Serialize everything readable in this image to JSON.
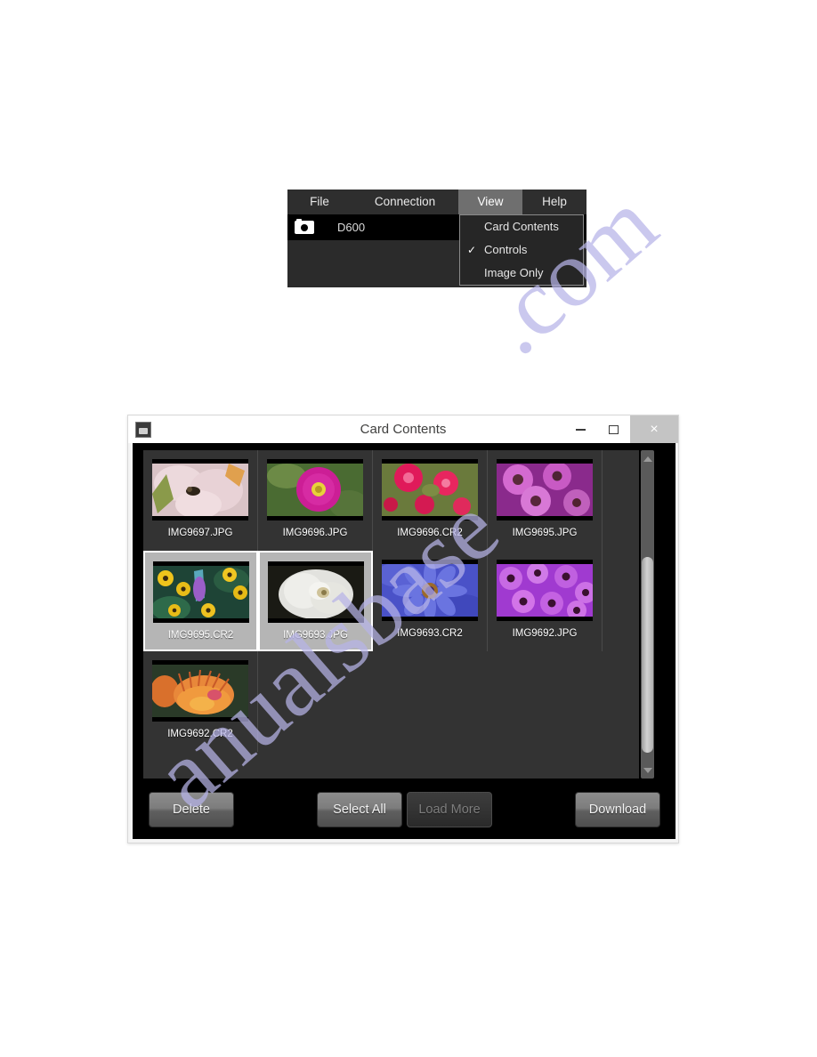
{
  "menu_figure": {
    "menubar": [
      {
        "label": "File",
        "active": false
      },
      {
        "label": "Connection",
        "active": false
      },
      {
        "label": "View",
        "active": true
      },
      {
        "label": "Help",
        "active": false
      }
    ],
    "device": {
      "icon": "camera-icon",
      "name": "D600"
    },
    "dropdown": {
      "parent": "View",
      "items": [
        {
          "label": "Card Contents",
          "checked": false
        },
        {
          "label": "Controls",
          "checked": true
        },
        {
          "label": "Image Only",
          "checked": false
        }
      ],
      "check_glyph": "✓"
    }
  },
  "window": {
    "icon": "app-camera-icon",
    "title": "Card Contents",
    "controls": {
      "minimize": "–",
      "maximize": "□",
      "close": "×"
    },
    "grid": {
      "rows": [
        [
          {
            "filename": "IMG9697.JPG",
            "selected": false
          },
          {
            "filename": "IMG9696.JPG",
            "selected": false
          },
          {
            "filename": "IMG9696.CR2",
            "selected": false
          },
          {
            "filename": "IMG9695.JPG",
            "selected": false
          }
        ],
        [
          {
            "filename": "IMG9695.CR2",
            "selected": true
          },
          {
            "filename": "IMG9693.JPG",
            "selected": true
          },
          {
            "filename": "IMG9693.CR2",
            "selected": false
          },
          {
            "filename": "IMG9692.JPG",
            "selected": false
          }
        ],
        [
          {
            "filename": "IMG9692.CR2",
            "selected": false
          }
        ]
      ]
    },
    "scrollbar": {
      "up_arrow": "scroll-up-arrow",
      "down_arrow": "scroll-down-arrow"
    },
    "buttons": {
      "delete": "Delete",
      "select_all": "Select All",
      "load_more": "Load More",
      "load_more_disabled": true,
      "download": "Download"
    }
  },
  "watermark": {
    "line_a": ".com",
    "line_b": "anualsbase"
  },
  "colors": {
    "menubar_bg": "#2e2e2e",
    "menu_active": "#6f6f6f",
    "panel_bg": "#2b2b2b",
    "dropdown_bg": "#262626",
    "window_frame": "#f4f4f4",
    "window_body": "#000000",
    "grid_bg": "#333333",
    "cell_selected": "#b5b5b5",
    "scrollbar_track": "#5a5a5a",
    "watermark": "#b7b4e8"
  }
}
